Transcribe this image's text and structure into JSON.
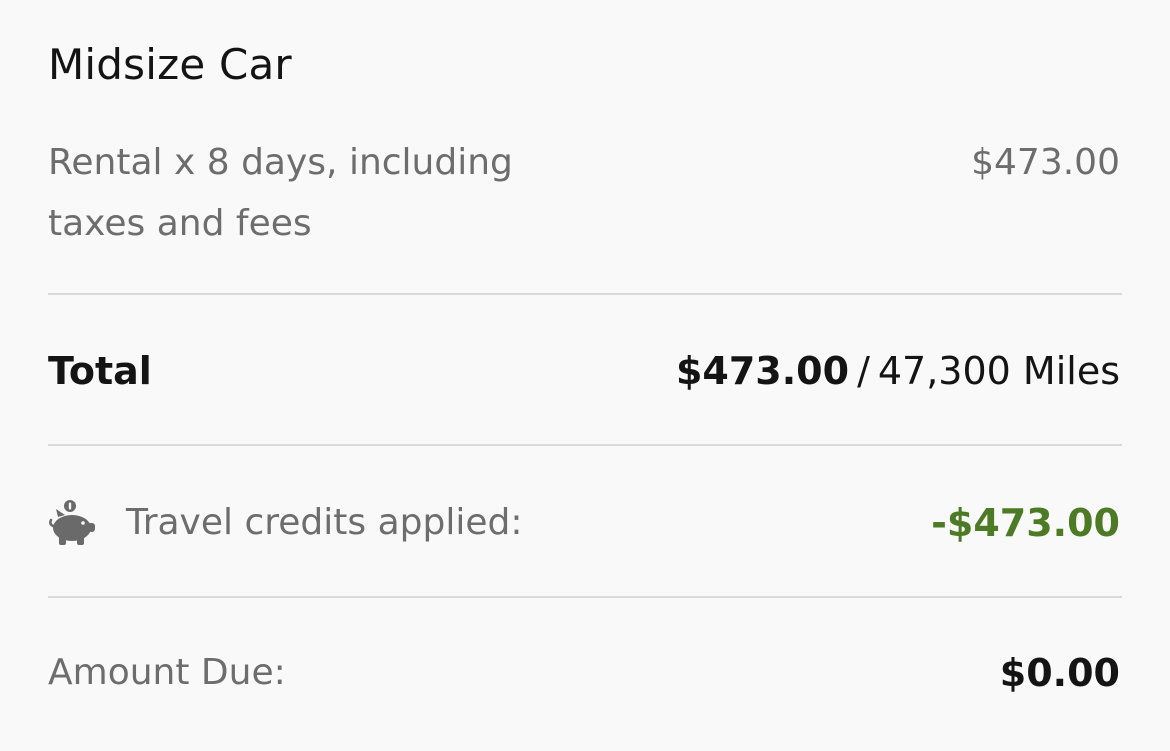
{
  "summary": {
    "title": "Midsize Car",
    "rental": {
      "description": "Rental x 8 days, including taxes and fees",
      "price": "$473.00"
    },
    "total": {
      "label": "Total",
      "amount": "$473.00",
      "separator": "/",
      "miles": "47,300 Miles"
    },
    "credits": {
      "icon": "piggy-bank-icon",
      "label": "Travel credits applied:",
      "amount": "-$473.00",
      "color": "#4d7a25"
    },
    "due": {
      "label": "Amount Due:",
      "amount": "$0.00"
    }
  }
}
